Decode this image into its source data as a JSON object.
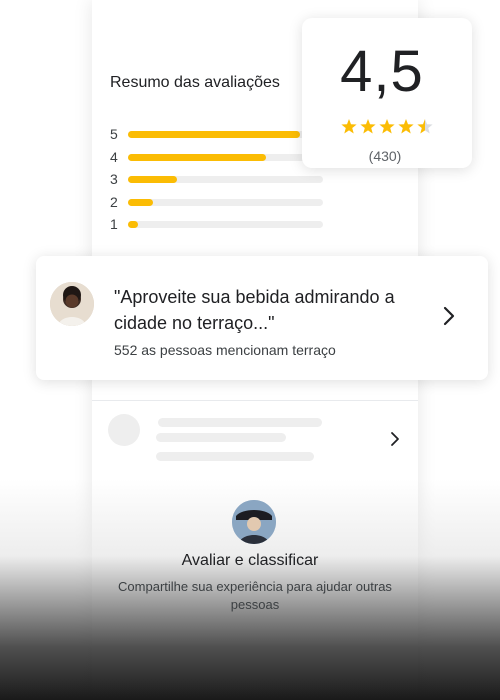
{
  "summary": {
    "title": "Resumo das avaliações",
    "rows": [
      {
        "label": "5",
        "fraction": 0.88
      },
      {
        "label": "4",
        "fraction": 0.71
      },
      {
        "label": "3",
        "fraction": 0.25
      },
      {
        "label": "2",
        "fraction": 0.13
      },
      {
        "label": "1",
        "fraction": 0.05
      }
    ]
  },
  "rating": {
    "value": "4,5",
    "stars": 4.5,
    "count": "(430)",
    "star_color": "#fbbc04"
  },
  "quote": {
    "text": "\"Aproveite sua bebida admirando a cidade no terraço...\"",
    "mentions": "552 as pessoas mencionam terraço"
  },
  "cta": {
    "title": "Avaliar e classificar",
    "subtitle": "Compartilhe sua experiência para ajudar outras pessoas"
  },
  "icons": {
    "quote_chevron": "chevron-right-icon",
    "placeholder_chevron": "chevron-right-icon"
  }
}
